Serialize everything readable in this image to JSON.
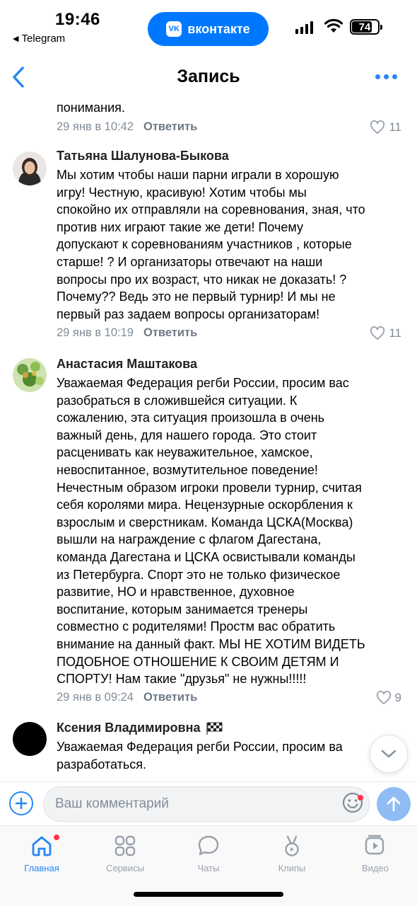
{
  "status_bar": {
    "time": "19:46",
    "back_app": "Telegram",
    "pill_label": "вконтакте",
    "battery": "74"
  },
  "navbar": {
    "title": "Запись"
  },
  "comments": [
    {
      "author": "",
      "text": "понимания.",
      "date": "29 янв в 10:42",
      "reply": "Ответить",
      "likes": "11"
    },
    {
      "author": "Татьяна Шалунова-Быкова",
      "text": "Мы хотим чтобы наши парни играли в хорошую\nигру!  Честную, красивую! Хотим чтобы мы\nспокойно их отправляли на соревнования, зная, что\nпротив них играют такие же дети!  Почему\nдопускают к соревнованиям участников , которые\nстарше! ? И организаторы отвечают на наши\nвопросы про их возраст, что никак не доказать! ?\nПочему??  Ведь это не первый турнир! И мы не\nпервый раз задаем вопросы организаторам!",
      "date": "29 янв в 10:19",
      "reply": "Ответить",
      "likes": "11"
    },
    {
      "author": "Анастасия Маштакова",
      "text": "Уважаемая Федерация регби России, просим вас\nразобраться в сложившейся ситуации. К\nсожалению, эта ситуация произошла в очень\nважный день, для нашего города. Это стоит\nрасценивать как неуважительное, хамское,\nневоспитанное, возмутительное поведение!\nНечестным образом игроки провели турнир, считая\nсебя королями мира. Нецензурные оскорбления к\nвзрослым и сверстникам. Команда ЦСКА(Москва)\nвышли на награждение с флагом Дагестана,\nкоманда Дагестана и ЦСКА  освистывали команды\nиз Петербурга. Спорт это не только физическое\nразвитие, НО и нравственное, духовное\nвоспитание, которым занимается тренеры\nсовместно с родителями! Простм вас обратить\nвнимание на данный факт. МЫ НЕ ХОТИМ ВИДЕТЬ\nПОДОБНОЕ ОТНОШЕНИЕ К СВОИМ ДЕТЯМ И\nСПОРТУ! Нам такие \"друзья\" не нужны!!!!!",
      "date": "29 янв в 09:24",
      "reply": "Ответить",
      "likes": "9"
    },
    {
      "author": "Ксения Владимировна",
      "text": "Уважаемая Федерация регби России, просим ва\nразработаться.",
      "date": "",
      "reply": "",
      "likes": ""
    }
  ],
  "composer": {
    "placeholder": "Ваш комментарий"
  },
  "tabs": [
    {
      "label": "Главная",
      "icon": "home-icon",
      "active": true
    },
    {
      "label": "Сервисы",
      "icon": "services-icon",
      "active": false
    },
    {
      "label": "Чаты",
      "icon": "chats-icon",
      "active": false
    },
    {
      "label": "Клипы",
      "icon": "clips-icon",
      "active": false
    },
    {
      "label": "Видео",
      "icon": "video-icon",
      "active": false
    }
  ],
  "colors": {
    "accent": "#2787f5",
    "vk_blue": "#0077ff",
    "secondary_text": "#818c99",
    "badge_red": "#ff3347"
  }
}
